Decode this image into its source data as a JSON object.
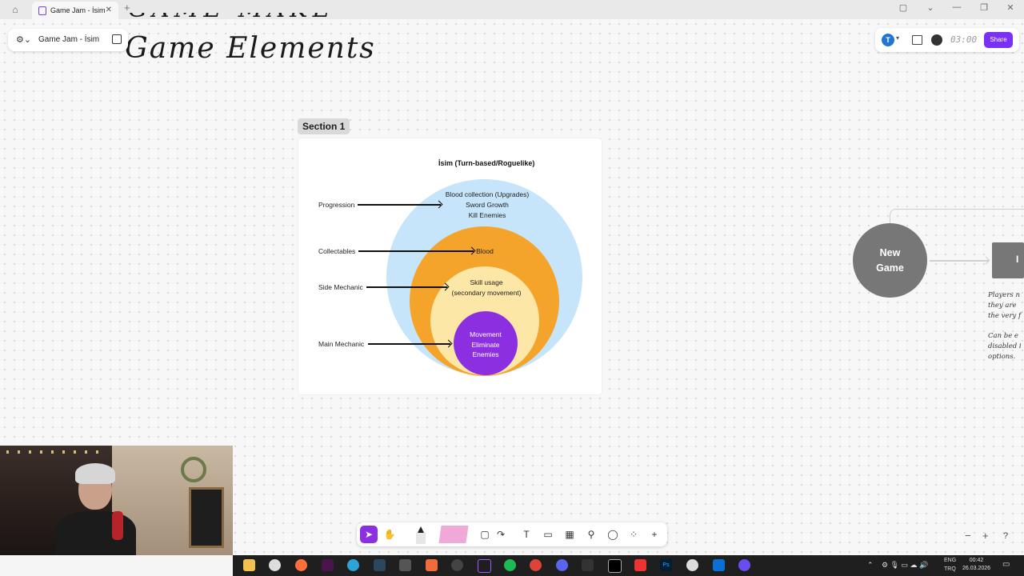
{
  "browser": {
    "tab_title": "Game Jam - İsim",
    "close_glyph": "✕",
    "new_tab_glyph": "+",
    "home_icon": "home-icon",
    "window_controls": [
      "▢",
      "⌄",
      "—",
      "❐",
      "✕"
    ]
  },
  "file": {
    "name": "Game Jam - İsim",
    "menu_icon": "figma-menu-icon",
    "pages_icon": "pages-icon"
  },
  "header": {
    "avatar_initial": "T",
    "timer": "03:00",
    "share_label": "Share",
    "share_color": "#7b2ff2"
  },
  "canvas": {
    "title": "Game Elements",
    "section_label": "Section 1"
  },
  "diagram": {
    "title": "İsim (Turn-based/Roguelike)",
    "labels": {
      "progression": "Progression",
      "collectables": "Collectables",
      "side_mechanic": "Side Mechanic",
      "main_mechanic": "Main Mechanic"
    },
    "rings": {
      "outer": [
        "Blood collection (Upgrades)",
        "Sword Growth",
        "Kill Enemies"
      ],
      "orange": [
        "Blood"
      ],
      "yellow": [
        "Skill usage",
        "(secondary movement)"
      ],
      "core": [
        "Movement",
        "Eliminate",
        "Enemies"
      ]
    },
    "colors": {
      "outer": "#c6e5fb",
      "orange": "#f4a42b",
      "yellow": "#fde7a7",
      "core": "#8b2fe0"
    }
  },
  "flow": {
    "node_label": [
      "New",
      "Game"
    ],
    "box_label": "I",
    "note_lines": [
      "Players n",
      "they are",
      "the very f",
      "",
      "Can be e",
      "disabled i",
      "options."
    ]
  },
  "toolbar": {
    "tools": [
      "select-tool",
      "hand-tool",
      "pen-tool",
      "sticky-tool",
      "shape-tool",
      "connector-tool",
      "text-tool",
      "frame-tool",
      "table-tool",
      "stamp-tool",
      "comment-tool",
      "widgets-tool",
      "more-tool"
    ],
    "glyphs": {
      "select": "➤",
      "hand": "✋",
      "shape": "▢",
      "connector": "↷",
      "text": "T",
      "frame": "▭",
      "table": "▦",
      "stamp": "⚲",
      "comment": "◯",
      "widgets": "⁘",
      "more": "+"
    }
  },
  "zoom": {
    "minus": "−",
    "plus": "+",
    "help": "?"
  },
  "taskbar": {
    "lang_top": "ENG",
    "lang_bottom": "TRQ",
    "time": "00:42",
    "date": "26.03.2026"
  }
}
